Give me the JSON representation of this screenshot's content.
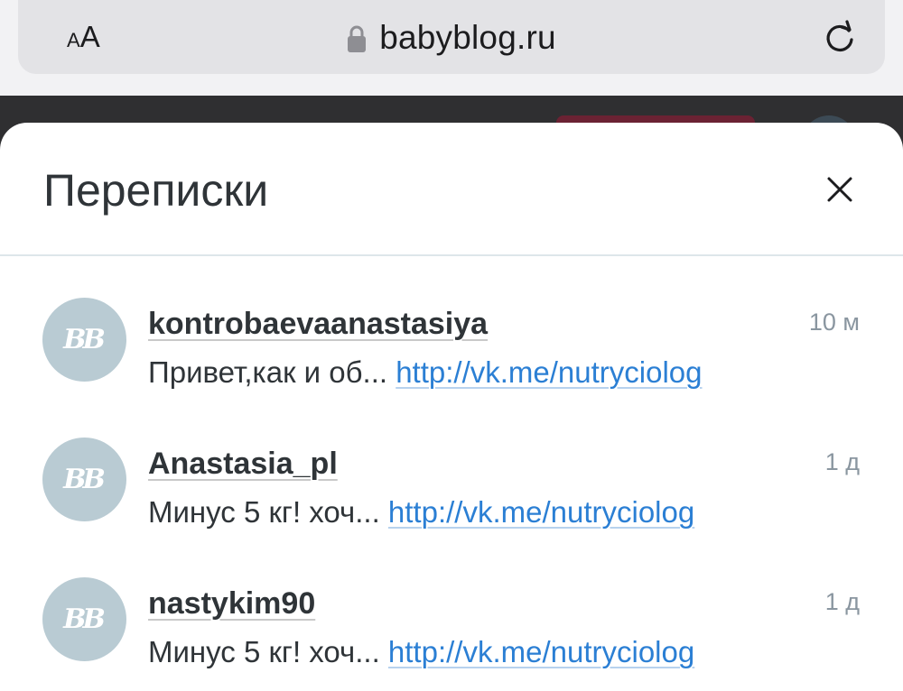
{
  "browser": {
    "text_size_small": "A",
    "text_size_large": "A",
    "url": "babyblog.ru",
    "lock_icon": "lock-icon",
    "reload_icon": "reload-icon"
  },
  "modal": {
    "title": "Переписки",
    "close_icon": "close-icon"
  },
  "conversations": [
    {
      "avatar_text": "BB",
      "username": "kontrobaevaanastasiya",
      "time": "10 м",
      "preview": "Привет,как и об...",
      "link": "http://vk.me/nutryciolog"
    },
    {
      "avatar_text": "BB",
      "username": "Anastasia_pl",
      "time": "1 д",
      "preview": "Минус 5 кг! хоч...",
      "link": "http://vk.me/nutryciolog"
    },
    {
      "avatar_text": "BB",
      "username": "nastykim90",
      "time": "1 д",
      "preview": "Минус 5 кг! хоч...",
      "link": "http://vk.me/nutryciolog"
    }
  ],
  "colors": {
    "link": "#2b7fd4",
    "avatar": "#b9cbd3",
    "title": "#2f3438",
    "time": "#8a96a0"
  }
}
